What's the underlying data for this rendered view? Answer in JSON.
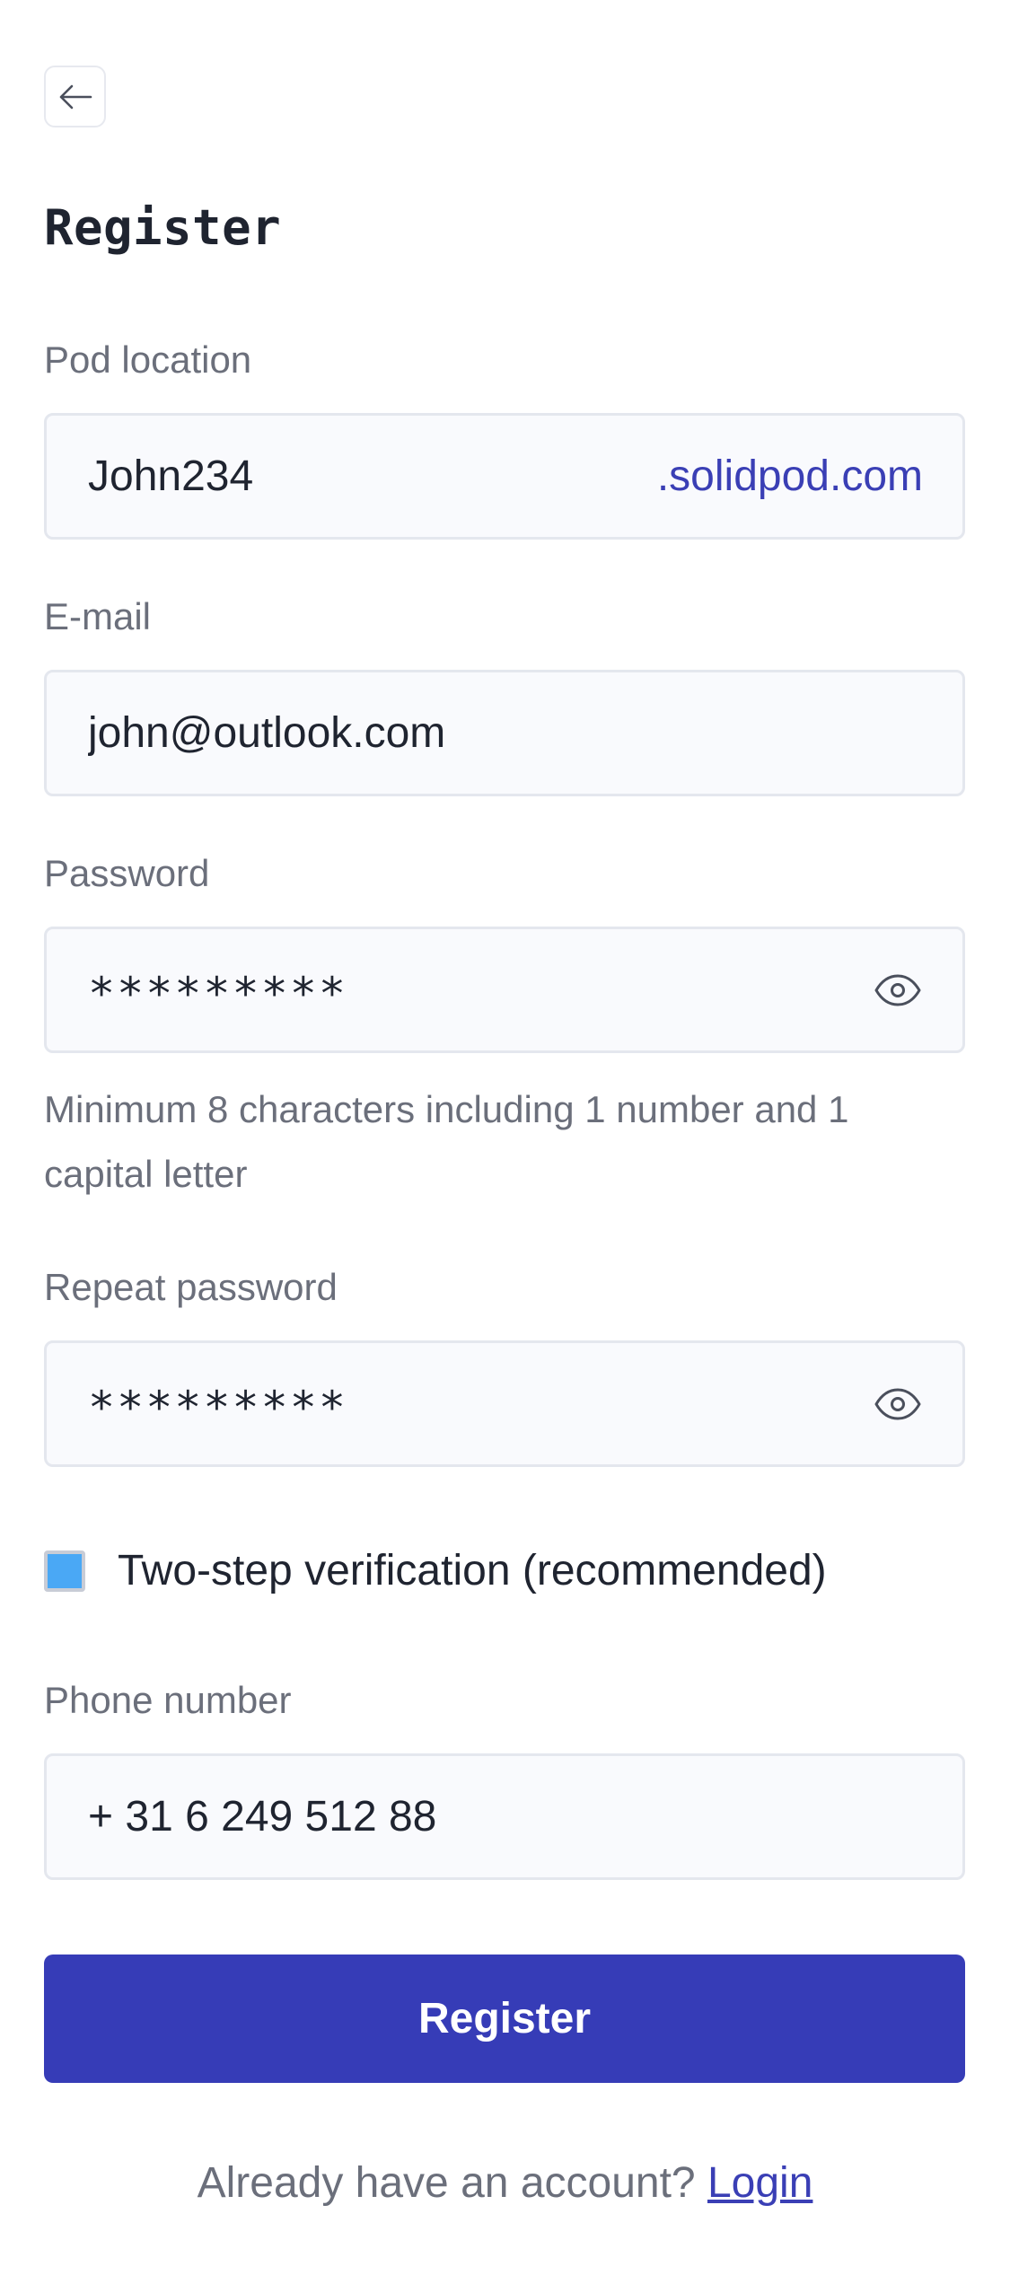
{
  "header": {
    "back_icon": "arrow-left-icon",
    "title": "Register"
  },
  "form": {
    "pod_location": {
      "label": "Pod location",
      "value": "John234",
      "suffix": ".solidpod.com"
    },
    "email": {
      "label": "E-mail",
      "value": "john@outlook.com"
    },
    "password": {
      "label": "Password",
      "value": "*********",
      "toggle_icon": "eye-icon",
      "helper": "Minimum 8 characters including 1 number and 1 capital letter"
    },
    "repeat_password": {
      "label": "Repeat password",
      "value": "*********",
      "toggle_icon": "eye-icon"
    },
    "two_step": {
      "label": "Two-step verification (recommended)",
      "checked": true
    },
    "phone": {
      "label": "Phone number",
      "value": "+ 31 6 249 512 88"
    },
    "submit_label": "Register"
  },
  "footer": {
    "prompt": "Already have an account?",
    "link_label": "Login"
  },
  "colors": {
    "primary": "#363cb7",
    "link": "#3a3fb5",
    "checkbox_fill": "#4aa8f5",
    "field_background": "#f9fafd",
    "field_border": "#e4e7ee",
    "label_text": "#6b6f7b"
  }
}
